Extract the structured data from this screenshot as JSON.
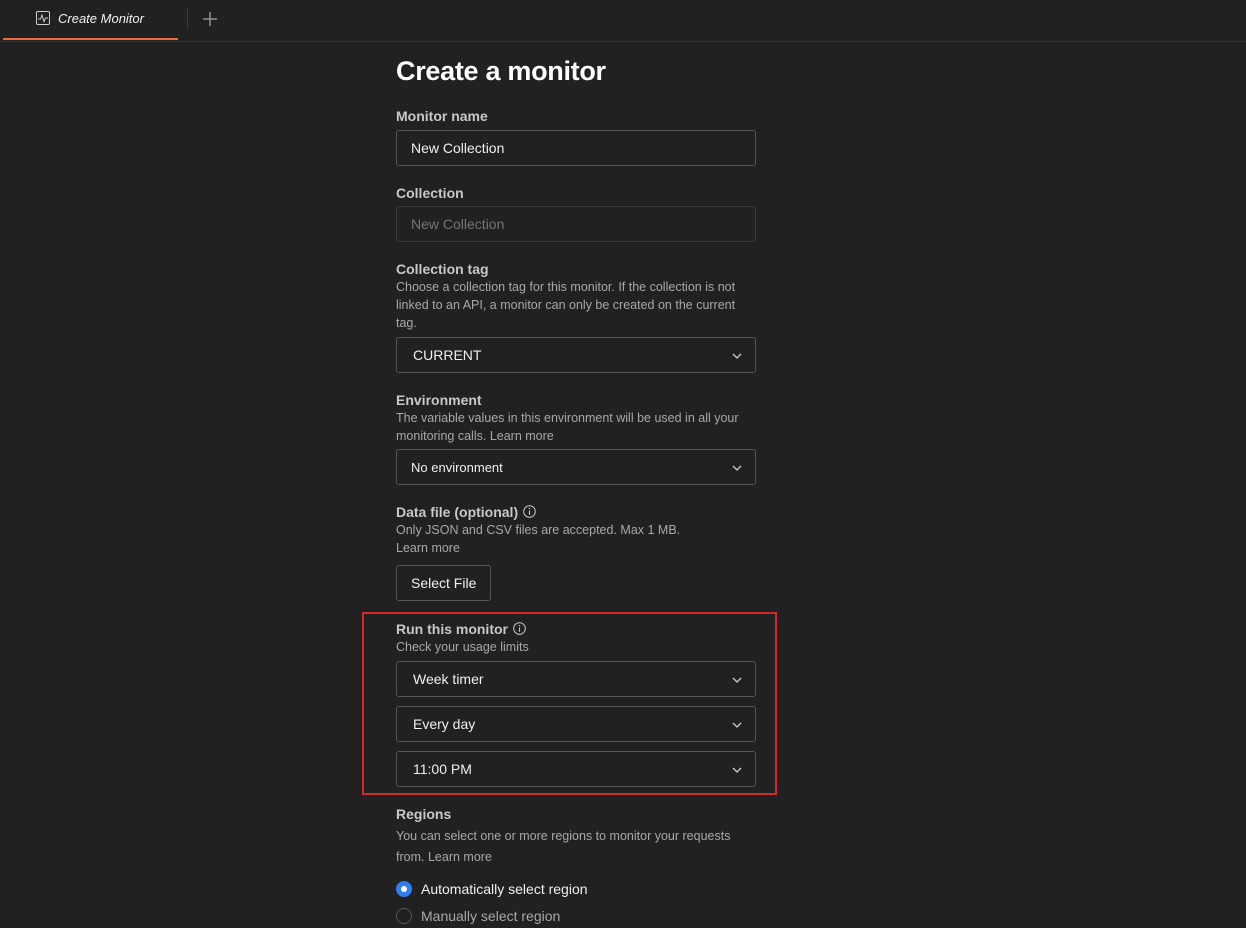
{
  "tabs": {
    "active_label": "Create Monitor",
    "new_tab_icon": "plus-icon"
  },
  "page": {
    "title": "Create a monitor"
  },
  "monitor_name": {
    "label": "Monitor name",
    "value": "New Collection"
  },
  "collection": {
    "label": "Collection",
    "placeholder": "New Collection"
  },
  "collection_tag": {
    "label": "Collection tag",
    "description": "Choose a collection tag for this monitor. If the collection is not linked to an API, a monitor can only be created on the current tag.",
    "selected": "CURRENT"
  },
  "environment": {
    "label": "Environment",
    "description": "The variable values in this environment will be used in all your monitoring calls.",
    "link": "Learn more",
    "selected": "No environment"
  },
  "data_file": {
    "label": "Data file (optional)",
    "description": "Only JSON and CSV files are accepted. Max 1 MB.",
    "link": "Learn more",
    "button": "Select File"
  },
  "schedule": {
    "label": "Run this monitor",
    "usage_link": "Check your usage limits",
    "timer_type": "Week timer",
    "frequency": "Every day",
    "time": "11:00 PM",
    "highlight_color": "#d42a2a"
  },
  "regions": {
    "label": "Regions",
    "description": "You can select one or more regions to monitor your requests from.",
    "link": "Learn more",
    "options": [
      {
        "label": "Automatically select region",
        "selected": true
      },
      {
        "label": "Manually select region",
        "selected": false
      }
    ]
  },
  "colors": {
    "background": "#212121",
    "tab_accent": "#f26b3a",
    "radio_selected": "#2f7ef2"
  }
}
